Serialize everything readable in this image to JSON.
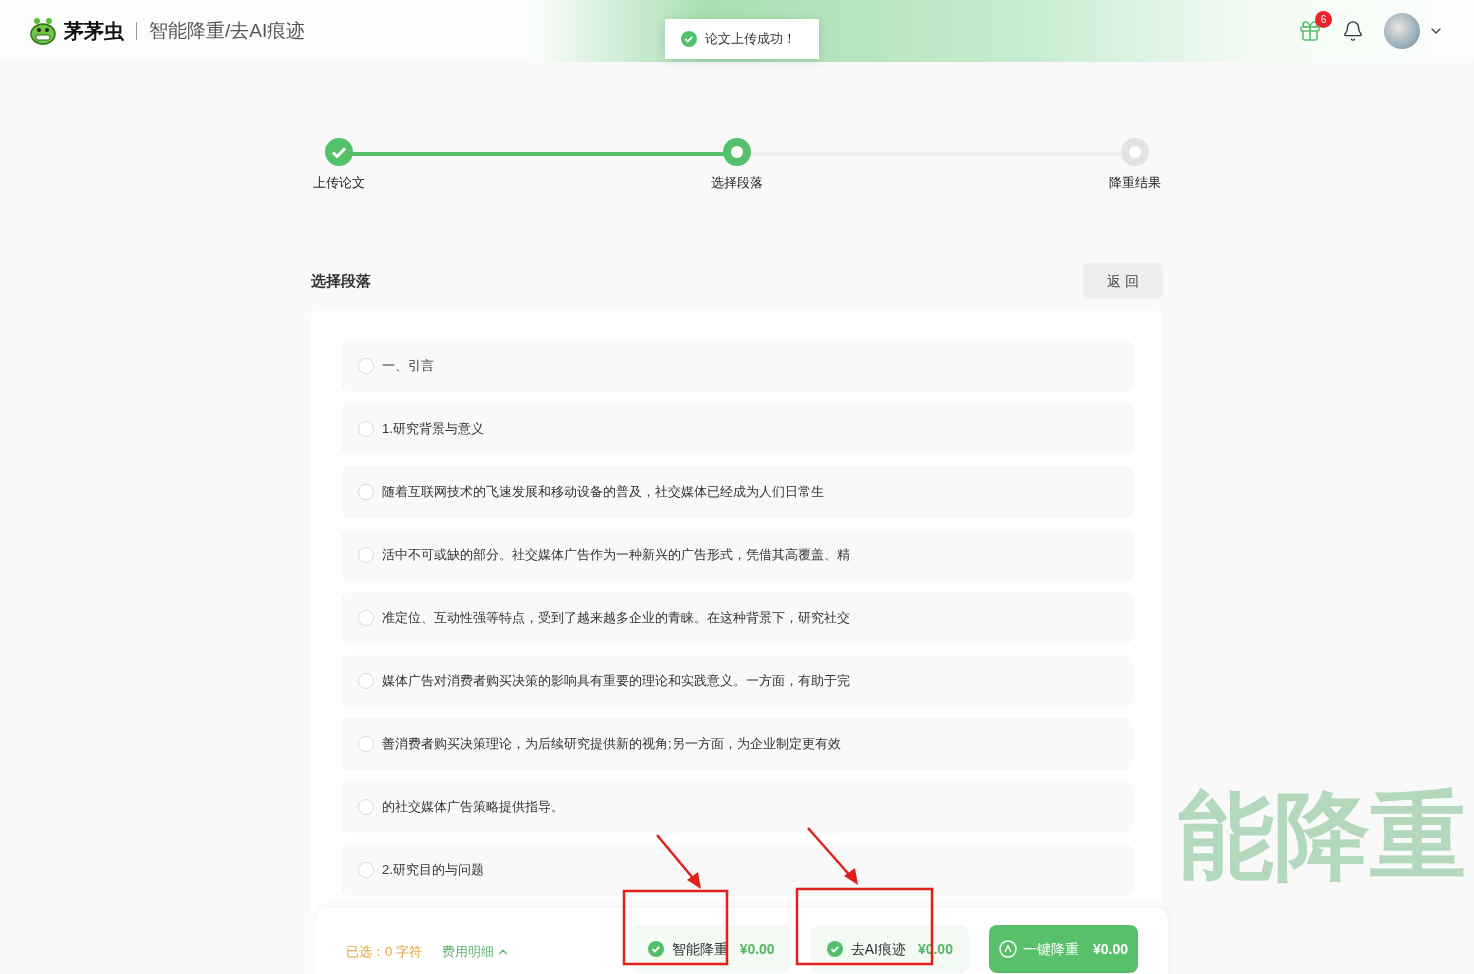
{
  "header": {
    "logo_text": "茅茅虫",
    "product": "智能降重/去AI痕迹",
    "gift_badge": "6"
  },
  "toast": {
    "message": "论文上传成功！"
  },
  "steps": [
    {
      "label": "上传论文",
      "kind": "done"
    },
    {
      "label": "选择段落",
      "kind": "current"
    },
    {
      "label": "降重结果",
      "kind": "pending"
    }
  ],
  "section": {
    "title": "选择段落",
    "back_button": "返 回"
  },
  "paragraphs": [
    {
      "text": "一、引言",
      "checked": false
    },
    {
      "text": "1.研究背景与意义",
      "checked": false
    },
    {
      "text": "随着互联网技术的飞速发展和移动设备的普及，社交媒体已经成为人们日常生",
      "checked": false
    },
    {
      "text": "活中不可或缺的部分。社交媒体广告作为一种新兴的广告形式，凭借其高覆盖、精",
      "checked": false
    },
    {
      "text": "准定位、互动性强等特点，受到了越来越多企业的青睐。在这种背景下，研究社交",
      "checked": false
    },
    {
      "text": "媒体广告对消费者购买决策的影响具有重要的理论和实践意义。一方面，有助于完",
      "checked": false
    },
    {
      "text": "善消费者购买决策理论，为后续研究提供新的视角;另一方面，为企业制定更有效",
      "checked": false
    },
    {
      "text": "的社交媒体广告策略提供指导。",
      "checked": false
    },
    {
      "text": "2.研究目的与问题",
      "checked": false
    }
  ],
  "watermark_text": "能降重",
  "bottom_bar": {
    "selected": "已选：0 字符",
    "fee_link": "费用明细",
    "options": [
      {
        "label": "智能降重",
        "price": "¥0.00",
        "checked": true
      },
      {
        "label": "去AI痕迹",
        "price": "¥0.00",
        "checked": true
      }
    ],
    "submit": {
      "label": "一键降重",
      "price": "¥0.00"
    }
  }
}
